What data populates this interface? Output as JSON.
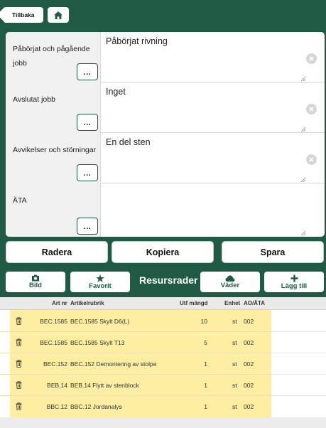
{
  "header": {
    "back_label": "Tillbaka",
    "home_icon": "home-icon"
  },
  "form": {
    "rows": [
      {
        "label": "Påbörjat och pågående jobb",
        "value": "Påbörjat rivning",
        "button_label": "..."
      },
      {
        "label": "Avslutat jobb",
        "value": "Inget",
        "button_label": "..."
      },
      {
        "label": "Avvikelser och störningar",
        "value": "En del sten",
        "button_label": "..."
      },
      {
        "label": "ÄTA",
        "value": "",
        "button_label": "..."
      }
    ]
  },
  "actions": {
    "delete_label": "Radera",
    "copy_label": "Kopiera",
    "save_label": "Spara"
  },
  "toolbar": {
    "photo_label": "Bild",
    "favorite_label": "Favorit",
    "title": "Resursrader",
    "weather_label": "Väder",
    "add_label": "Lägg till"
  },
  "table": {
    "headers": {
      "art_nr": "Art nr",
      "article_title": "Artikelrubrik",
      "qty": "Utf mängd",
      "unit": "Enhet",
      "ao": "AO/ÄTA"
    },
    "rows": [
      {
        "art_nr": "BEC.1585",
        "title": "BEC.1585 Skylt D6(L)",
        "qty": "10",
        "unit": "st",
        "ao": "002"
      },
      {
        "art_nr": "BEC.1585",
        "title": "BEC.1585 Skylt T13",
        "qty": "5",
        "unit": "st",
        "ao": "002"
      },
      {
        "art_nr": "BEC.152",
        "title": "BEC.152 Demontering av stolpe",
        "qty": "1",
        "unit": "st",
        "ao": "002"
      },
      {
        "art_nr": "BEB.14",
        "title": "BEB.14 Flytt av stenblock",
        "qty": "1",
        "unit": "st",
        "ao": "002"
      },
      {
        "art_nr": "BBC.12",
        "title": "BBC.12 Jordanalys",
        "qty": "1",
        "unit": "st",
        "ao": "002"
      }
    ]
  },
  "colors": {
    "brand": "#1f5a44",
    "highlight": "#fdeea2"
  }
}
